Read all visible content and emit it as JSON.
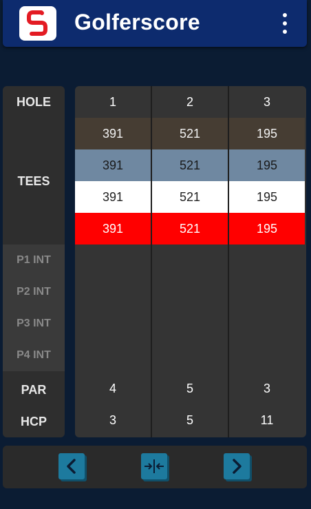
{
  "app": {
    "title": "Golferscore"
  },
  "labels": {
    "hole": "HOLE",
    "tees": "TEES",
    "p1": "P1 INT",
    "p2": "P2 INT",
    "p3": "P3 INT",
    "p4": "P4 INT",
    "par": "PAR",
    "hcp": "HCP"
  },
  "holes": [
    {
      "number": "1",
      "tees": [
        "391",
        "391",
        "391",
        "391"
      ],
      "par": "4",
      "hcp": "3"
    },
    {
      "number": "2",
      "tees": [
        "521",
        "521",
        "521",
        "521"
      ],
      "par": "5",
      "hcp": "5"
    },
    {
      "number": "3",
      "tees": [
        "195",
        "195",
        "195",
        "195"
      ],
      "par": "3",
      "hcp": "11"
    }
  ],
  "tee_colors": [
    "#463d33",
    "#6f88a1",
    "#ffffff",
    "#ff0000"
  ],
  "icons": {
    "logo": "golferscore-logo-icon",
    "menu": "more-vert-icon",
    "prev": "chevron-left-icon",
    "collapse": "collapse-horizontal-icon",
    "next": "chevron-right-icon"
  },
  "colors": {
    "appbar": "#0d2b6e",
    "background": "#0b1c33",
    "button": "#1d7a9e"
  }
}
